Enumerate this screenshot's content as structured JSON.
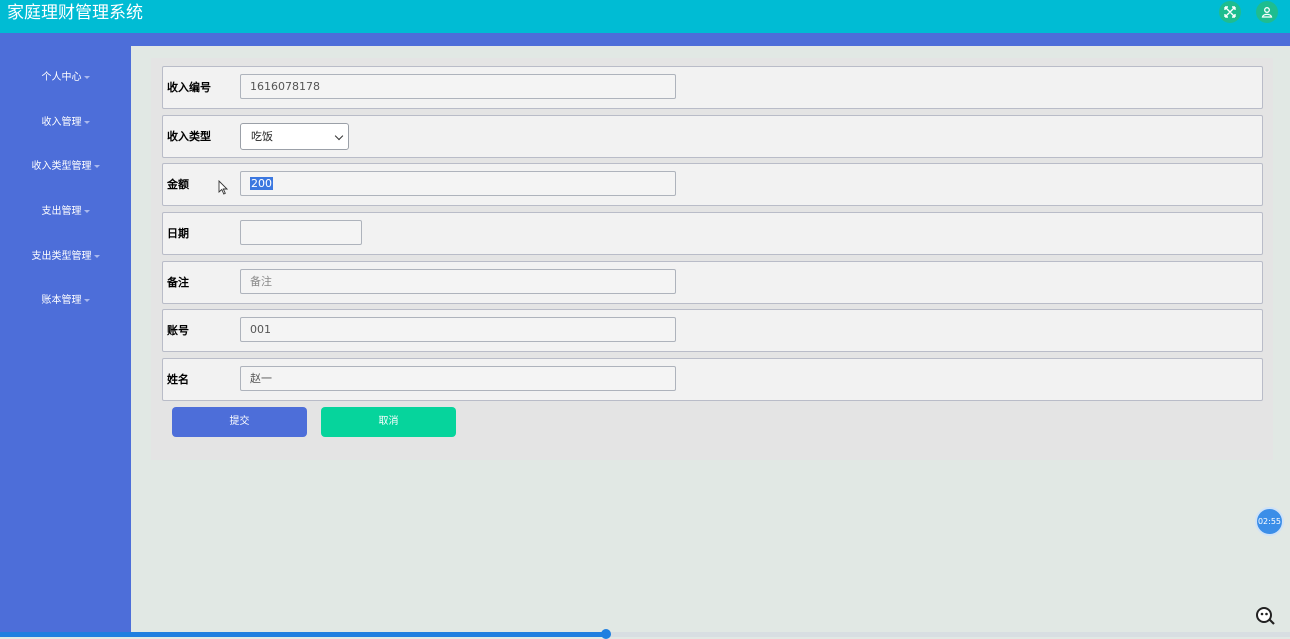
{
  "app": {
    "title": "家庭理财管理系统"
  },
  "topbar": {
    "icons": [
      "fullscreen-icon",
      "user-icon"
    ]
  },
  "sidebar": {
    "items": [
      {
        "label": "个人中心"
      },
      {
        "label": "收入管理"
      },
      {
        "label": "收入类型管理"
      },
      {
        "label": "支出管理"
      },
      {
        "label": "支出类型管理"
      },
      {
        "label": "账本管理"
      }
    ]
  },
  "form": {
    "income_no": {
      "label": "收入编号",
      "value": "1616078178"
    },
    "income_type": {
      "label": "收入类型",
      "value": "吃饭"
    },
    "amount": {
      "label": "金额",
      "value": "200"
    },
    "date": {
      "label": "日期",
      "value": ""
    },
    "remark": {
      "label": "备注",
      "placeholder": "备注"
    },
    "account": {
      "label": "账号",
      "value": "001"
    },
    "name": {
      "label": "姓名",
      "value": "赵一"
    },
    "submit_label": "提交",
    "cancel_label": "取消"
  },
  "overlay": {
    "timer": "02:55",
    "progress": 0.47,
    "colors": {
      "accent": "#1f7fe0"
    }
  }
}
